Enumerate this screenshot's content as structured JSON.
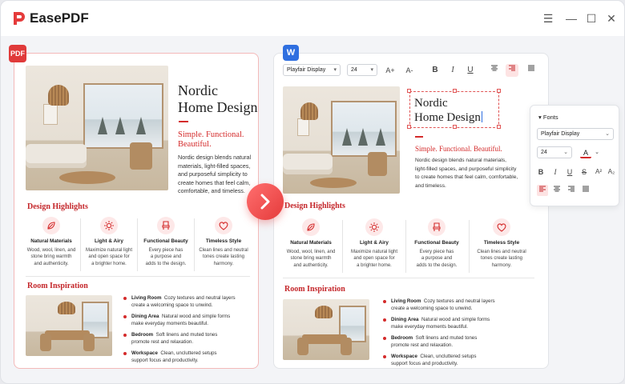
{
  "app": {
    "name": "EasePDF"
  },
  "window_controls": {
    "menu": "☰",
    "minimize": "—",
    "maximize": "☐",
    "close": "✕"
  },
  "badges": {
    "pdf": "PDF",
    "word": "W"
  },
  "colors": {
    "accent": "#d42b2b",
    "word_blue": "#2f6fe0",
    "pdf_red": "#e03a3a"
  },
  "doc": {
    "title_line1": "Nordic",
    "title_line2": "Home Design",
    "subtitle_line1": "Simple. Functional.",
    "subtitle_line2": "Beautiful.",
    "subtitle_one_line": "Simple. Functional. Beautiful.",
    "intro_left": [
      "Nordic design blends natural",
      "materials, light-filled spaces,",
      "and purposeful simplicity to",
      "create homes that feel calm,",
      "comfortable, and timeless."
    ],
    "intro_right": [
      "Nordic design blends natural materials,",
      "light-filled spaces, and purposeful simplicity",
      "to create homes that feel calm, comfortable,",
      "and timeless."
    ],
    "highlights_heading": "Design Highlights",
    "features": [
      {
        "icon": "leaf-icon",
        "title": "Natural Materials",
        "desc": [
          "Wood, wool, linen, and",
          "stone bring warmth",
          "and authenticity."
        ]
      },
      {
        "icon": "sun-icon",
        "title": "Light & Airy",
        "desc": [
          "Maximize natural light",
          "and open space for",
          "a brighter home."
        ]
      },
      {
        "icon": "chair-icon",
        "title": "Functional Beauty",
        "desc": [
          "Every piece has",
          "a purpose and",
          "adds to the design."
        ]
      },
      {
        "icon": "heart-icon",
        "title": "Timeless Style",
        "desc": [
          "Clean lines and neutral",
          "tones create lasting",
          "harmony."
        ]
      }
    ],
    "inspiration_heading": "Room Inspiration",
    "rooms": [
      {
        "name": "Living Room",
        "desc1": "Cozy textures and neutral layers",
        "desc2": "create a welcoming space to unwind."
      },
      {
        "name": "Dining Area",
        "desc1": "Natural wood and simple forms",
        "desc2": "make everyday moments beautiful."
      },
      {
        "name": "Bedroom",
        "desc1": "Soft linens and muted tones",
        "desc2": "promote rest and relaxation."
      },
      {
        "name": "Workspace",
        "desc1": "Clean, uncluttered setups",
        "desc2": "support focus and productivity."
      }
    ]
  },
  "toolbar": {
    "font_family": "Playfair Display",
    "font_size": "24",
    "grow_font": "A+",
    "shrink_font": "A-",
    "bold": "B",
    "italic": "I",
    "underline": "U"
  },
  "fonts_panel": {
    "title": "Fonts",
    "font_family": "Playfair Display",
    "font_size": "24",
    "color_letter": "A",
    "bold": "B",
    "italic": "I",
    "underline": "U",
    "strike": "S",
    "superscript": "A²",
    "subscript": "A₂"
  }
}
